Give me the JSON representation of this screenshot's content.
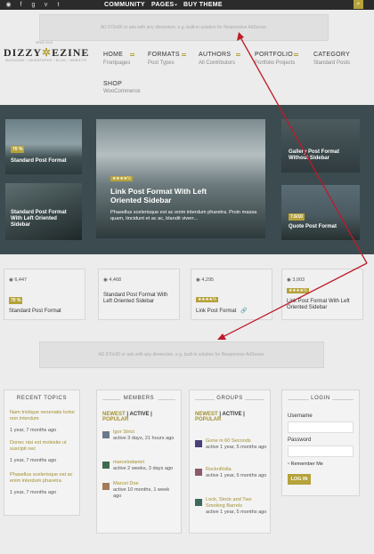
{
  "topbar": {
    "social": [
      "rss-icon",
      "facebook-icon",
      "google-plus-icon",
      "vimeo-icon",
      "twitter-icon"
    ],
    "nav": [
      "COMMUNITY",
      "PAGES",
      "BUY THEME"
    ]
  },
  "ad_text": "AD 970x90 or ads with any dimension, e.g. built-in solution for Responsive AdSense.",
  "logo": {
    "left": "DIZZY",
    "right": "EZINE",
    "since": "SINCE 2013",
    "tagline": "MAGAZINE / NEWSPAPER / BLOG / WEBSITE"
  },
  "menu": [
    {
      "label": "HOME",
      "sub": "Frontpages"
    },
    {
      "label": "FORMATS",
      "sub": "Post Types"
    },
    {
      "label": "AUTHORS",
      "sub": "All Contributors"
    },
    {
      "label": "PORTFOLIO",
      "sub": "Portfolio Projects"
    },
    {
      "label": "CATEGORY",
      "sub": "Standard Posts"
    },
    {
      "label": "SHOP",
      "sub": "WooCommerce"
    }
  ],
  "hero": {
    "t1": {
      "badge": "70 %",
      "title": "Standard Post Format"
    },
    "t2": {
      "title": "Standard Post Format With Left Oriented Sidebar"
    },
    "main": {
      "stars": "★★★★½",
      "title": "Link Post Format With Left Oriented Sidebar",
      "excerpt": "Phasellus scelerisque est ac enim interdum pharetra. Proin massa quam, tincidunt et ac ac, blandit viverr..."
    },
    "t4": {
      "title": "Gallery Post Format Without Sidebar"
    },
    "t5": {
      "badge": "7.6/10",
      "title": "Quote Post Format"
    }
  },
  "cards": [
    {
      "views": "6,447",
      "badge": "70 %",
      "title": "Standard Post Format"
    },
    {
      "views": "4,468",
      "title": "Standard Post Format With Left Oriented Sidebar"
    },
    {
      "views": "4,295",
      "stars": "★★★★½",
      "title": "Link Post Format"
    },
    {
      "views": "3,003",
      "stars": "★★★★½",
      "title": "Link Post Format With Left Oriented Sidebar"
    }
  ],
  "recent": {
    "title": "RECENT TOPICS",
    "items": [
      {
        "title": "Nam tristique venenatis tortor non interdum",
        "date": "1 year, 7 months ago"
      },
      {
        "title": "Donec nisi est molestie ut suscipit nec",
        "date": "1 year, 7 months ago"
      },
      {
        "title": "Phasellus scelerisque est ac enim interdum pharetra",
        "date": "1 year, 7 months ago"
      }
    ]
  },
  "members": {
    "title": "MEMBERS",
    "tabs": {
      "newest": "NEWEST",
      "sep": "|",
      "active": "ACTIVE",
      "sep2": "|",
      "popular": "POPULAR"
    },
    "items": [
      {
        "name": "Igor Strict",
        "info": "active 3 days, 21 hours ago"
      },
      {
        "name": "marcelodaniel",
        "info": "active 2 weeks, 3 days ago"
      },
      {
        "name": "Marcel Doe",
        "info": "active 10 months, 1 week ago"
      }
    ]
  },
  "groups": {
    "title": "GROUPS",
    "items": [
      {
        "name": "Gone in 60 Seconds",
        "info": "active 1 year, 5 months ago"
      },
      {
        "name": "RocknRolla",
        "info": "active 1 year, 5 months ago"
      },
      {
        "name": "Lock, Stock and Two Smoking Barrels",
        "info": "active 1 year, 5 months ago"
      }
    ]
  },
  "login": {
    "title": "LOGIN",
    "username": "Username",
    "password": "Password",
    "remember": "Remember Me",
    "button": "LOG IN"
  },
  "colors": {
    "accent": "#b5a23a",
    "arrow": "#c0192a"
  }
}
